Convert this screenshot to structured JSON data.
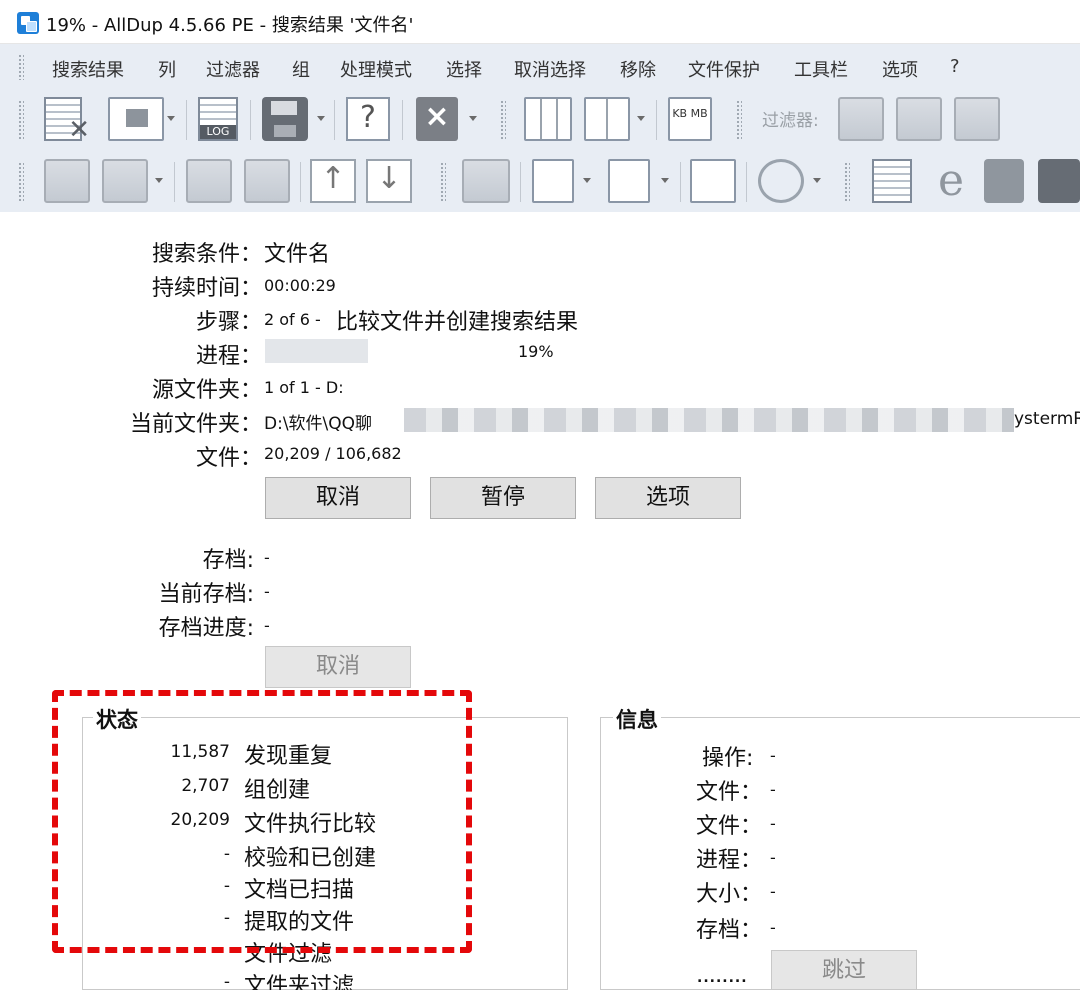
{
  "window": {
    "title": "19% - AllDup 4.5.66 PE - 搜索结果 '文件名'"
  },
  "menu": {
    "items": [
      "搜索结果",
      "列",
      "过滤器",
      "组",
      "处理模式",
      "选择",
      "取消选择",
      "移除",
      "文件保护",
      "工具栏",
      "选项",
      "?"
    ]
  },
  "toolbar": {
    "filter_label": "过滤器:",
    "log_icon_text": "LOG",
    "size_icon_text": "KB MB",
    "icons": [
      "delete-files-icon",
      "view-icon",
      "log-icon",
      "save-icon",
      "help-icon",
      "close-icon",
      "columns-icon",
      "column-width-icon",
      "size-units-icon",
      "filter-folder-icon",
      "filter-check-icon",
      "filter-partial-icon",
      "folder-back-icon",
      "folder-forward-icon",
      "folder-up-icon",
      "folder-down-icon",
      "move-up-icon",
      "move-down-icon",
      "folder-settings-icon",
      "select-file-icon",
      "deselect-file-icon",
      "toggle-select-icon",
      "undo-icon",
      "text-view-icon",
      "internet-explorer-icon",
      "media-icon",
      "image-icon"
    ]
  },
  "search": {
    "criteria_label": "搜索条件：",
    "criteria_value": "文件名",
    "duration_label": "持续时间：",
    "duration_value": "00:00:29",
    "step_label": "步骤：",
    "step_value": "2 of 6 - ",
    "step_text": "比较文件并创建搜索结果",
    "progress_label": "进程：",
    "progress_percent": "19%",
    "progress_fraction": 0.19,
    "source_folder_label": "源文件夹：",
    "source_folder_value": "1 of 1 - D:",
    "current_folder_label": "当前文件夹：",
    "current_folder_value": "D:\\软件\\QQ聊",
    "current_folder_tail": "ystermR",
    "files_label": "文件：",
    "files_value": "20,209 / 106,682"
  },
  "buttons": {
    "cancel": "取消",
    "pause": "暂停",
    "options": "选项",
    "archive_cancel": "取消",
    "skip": "跳过"
  },
  "archive": {
    "archive_label": "存档:",
    "archive_value": "-",
    "current_archive_label": "当前存档:",
    "current_archive_value": "-",
    "archive_progress_label": "存档进度:",
    "archive_progress_value": "-"
  },
  "status": {
    "title": "状态",
    "rows": [
      {
        "num": "11,587",
        "text": "发现重复"
      },
      {
        "num": "2,707",
        "text": "组创建"
      },
      {
        "num": "20,209",
        "text": "文件执行比较"
      },
      {
        "num": "-",
        "text": "校验和已创建"
      },
      {
        "num": "-",
        "text": "文档已扫描"
      },
      {
        "num": "-",
        "text": "提取的文件"
      },
      {
        "num": "",
        "text": "文件过滤"
      },
      {
        "num": "-",
        "text": "文件夹过滤"
      }
    ]
  },
  "info": {
    "title": "信息",
    "rows": [
      {
        "label": "操作:",
        "value": "-"
      },
      {
        "label": "文件：",
        "value": "-"
      },
      {
        "label": "文件：",
        "value": "-"
      },
      {
        "label": "进程：",
        "value": "-"
      },
      {
        "label": "大小：",
        "value": "-"
      },
      {
        "label": "存档：",
        "value": "-"
      }
    ],
    "dots": "........"
  },
  "colors": {
    "highlight": "#e4080a",
    "toolbar_bg": "#e8edf4",
    "app_icon": "#1e7fd8"
  }
}
